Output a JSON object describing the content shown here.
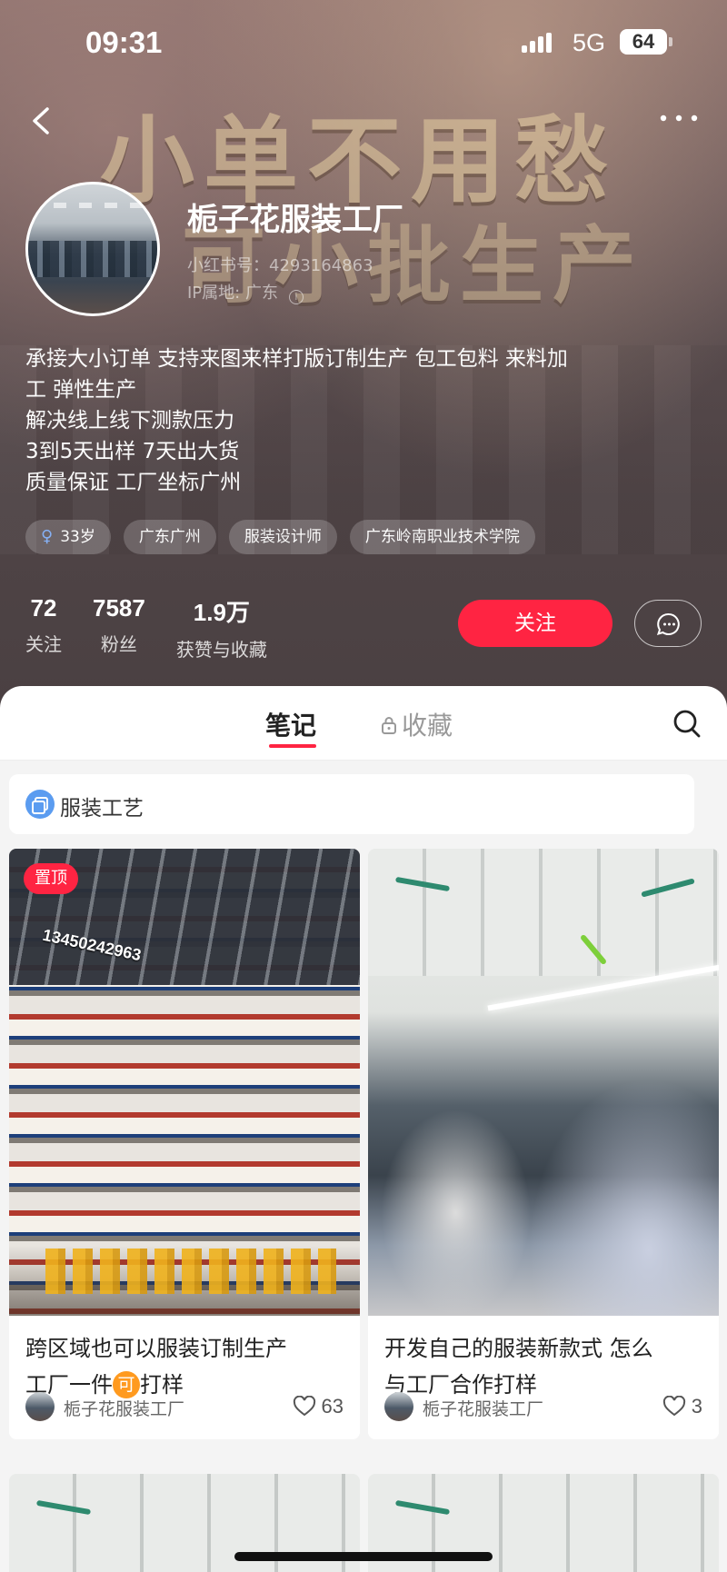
{
  "status_bar": {
    "time": "09:31",
    "network": "5G",
    "battery": "64"
  },
  "banner": {
    "line1": "小单不用愁",
    "line2": "可小批生产"
  },
  "profile": {
    "name": "栀子花服装工厂",
    "redbook_id": "小红书号：4293164863",
    "ip_location": "IP属地: 广东",
    "bio_lines": [
      "承接大小订单 支持来图来样打版订制生产            包工包料 来料加",
      "工 弹性生产",
      "解决线上线下测款压力",
      "3到5天出样 7天出大货",
      "质量保证  工厂坐标广州"
    ],
    "tags": [
      "33岁",
      "广东广州",
      "服装设计师",
      "广东岭南职业技术学院"
    ],
    "gender_icon": "female-icon"
  },
  "stats": [
    {
      "value": "72",
      "label": "关注"
    },
    {
      "value": "7587",
      "label": "粉丝"
    },
    {
      "value": "1.9万",
      "label": "获赞与收藏"
    }
  ],
  "actions": {
    "follow_label": "关注"
  },
  "tabs": {
    "notes": "笔记",
    "collections": "收藏"
  },
  "collection": {
    "label": "服装工艺"
  },
  "posts": [
    {
      "pinned_label": "置顶",
      "overlay_text": "13450242963",
      "title_part1": "跨区域也可以服装订制生产",
      "title_part2": "工厂一件",
      "title_badge": "可",
      "title_part3": "打样",
      "author": "栀子花服装工厂",
      "likes": "63"
    },
    {
      "title_part1": "开发自己的服装新款式 怎么",
      "title_part2": "与工厂合作打样",
      "author": "栀子花服装工厂",
      "likes": "3"
    }
  ],
  "colors": {
    "accent": "#ff2442",
    "badge": "#ff9a1f",
    "collection_icon": "#5b9cf0"
  }
}
